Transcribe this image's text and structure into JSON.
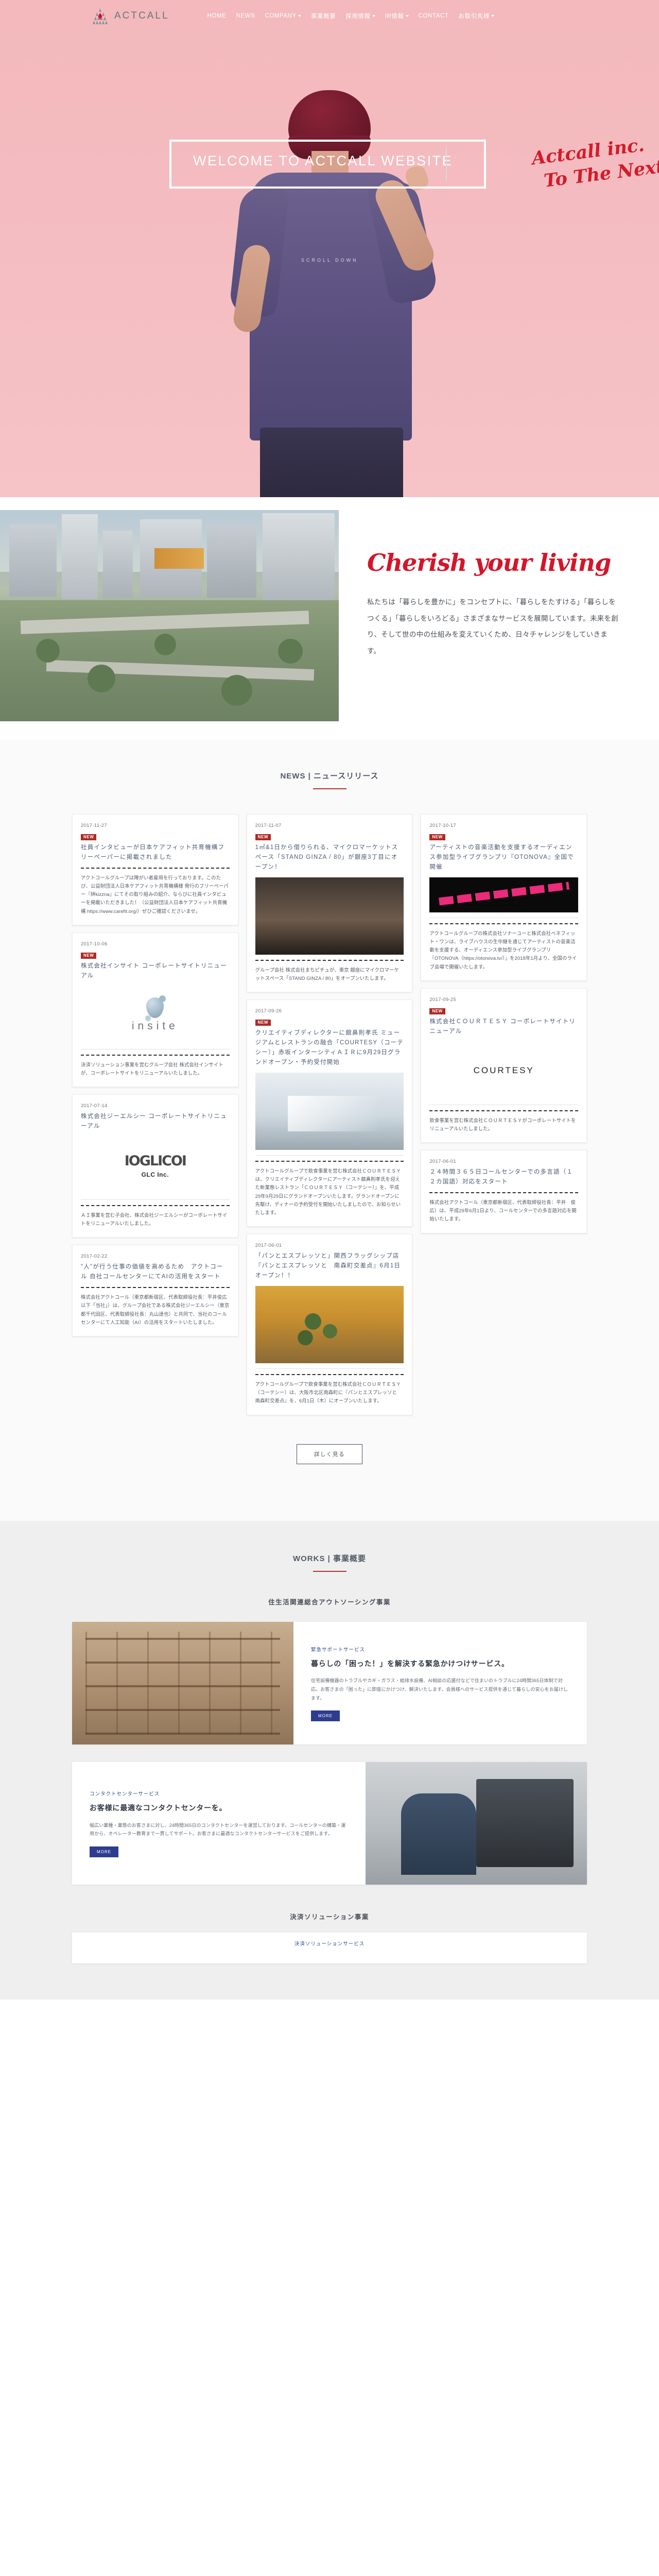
{
  "site": {
    "brand": "ACTCALL",
    "logo_icon": "actcall-triangle-logo"
  },
  "nav": {
    "items": [
      {
        "label": "HOME",
        "has_dropdown": false
      },
      {
        "label": "NEWS",
        "has_dropdown": false
      },
      {
        "label": "COMPANY",
        "has_dropdown": true
      },
      {
        "label": "事業概要",
        "has_dropdown": false
      },
      {
        "label": "採用情報",
        "has_dropdown": true
      },
      {
        "label": "IR情報",
        "has_dropdown": true
      },
      {
        "label": "CONTACT",
        "has_dropdown": false
      },
      {
        "label": "お取引先様",
        "has_dropdown": true
      }
    ]
  },
  "hero": {
    "frame_text": "WELCOME TO ACTCALL WEBSITE",
    "script_line1": "Actcall inc.",
    "script_line2": "To The Next",
    "scroll_hint": "SCROLL DOWN"
  },
  "cherish": {
    "heading": "Cherish your living",
    "body": "私たちは「暮らしを豊かに」をコンセプトに、「暮らしをたすける」「暮らしをつくる」「暮らしをいろどる」さまざまなサービスを展開しています。未来を創り、そして世の中の仕組みを変えていくため、日々チャレンジをしていきます。"
  },
  "news": {
    "title": "NEWS | ニュースリリース",
    "more_button": "詳しく見る",
    "columns": [
      {
        "cards": [
          {
            "date": "2017-11-27",
            "badge": "NEW",
            "title": "社員インタビューが日本ケアフィット共育機構フリーペーパーに掲載されました",
            "image": null,
            "logo": null,
            "body": "アクトコールグループは障がい者雇用を行っております。このたび、公益財団法人日本ケアフィット共育機構様 発行のフリーペーパー『絆kizzna』にてその取り組みの紹介、ならびに社員インタビューを掲載いただきました！（公益財団法人日本ケアフィット共育機構 https://www.carefit.org/）ぜひご確認くださいませ。"
          },
          {
            "date": "2017-10-06",
            "badge": "NEW",
            "title": "株式会社インサイト コーポレートサイトリニューアル",
            "image": null,
            "logo": "insite",
            "body": "決済ソリューション事業を営むグループ会社 株式会社インサイトが、コーポレートサイトをリニューアルいたしました。"
          },
          {
            "date": "2017-07-14",
            "badge": null,
            "title": "株式会社ジーエルシー コーポレートサイトリニューアル",
            "image": null,
            "logo": "glc",
            "body": "ＡＩ事業を営む子会社、株式会社ジーエルシーがコーポレートサイトをリニューアルいたしました。"
          },
          {
            "date": "2017-02-22",
            "badge": null,
            "title": "\"人\"が行う仕事の価値を高めるため　アクトコール 自社コールセンターにてAIの活用をスタート",
            "image": null,
            "logo": null,
            "body": "株式会社アクトコール（東京都新宿区、代表取締役社長：平井俊広 以下「当社」）は、グループ会社である株式会社ジーエルシー（東京都千代田区、代表取締役社長：丸山達也）と共同で、当社のコールセンターにて人工知能（AI）の活用をスタートいたしました。"
          }
        ]
      },
      {
        "cards": [
          {
            "date": "2017-11-07",
            "badge": "NEW",
            "title": "1㎡&1日から借りられる、マイクロマーケットスペース「STAND GINZA / 80」が銀座3丁目にオープン！",
            "image": "stand-ginza-photo",
            "logo": null,
            "body": "グループ会社 株式会社まちピチュが、東京 銀座にマイクロマーケットスペース「STAND GINZA / 80」をオープンいたします。"
          },
          {
            "date": "2017-09-26",
            "badge": "NEW",
            "title": "クリエイティブディレクターに舘鼻則孝氏 ミュージアムとレストランの融合「COURTESY（コーテシー）」赤坂インターシティＡＩＲに9月29日グランドオープン・予約受付開始",
            "image": "courtesy-interior-photo",
            "logo": null,
            "body": "アクトコールグループで飲食事業を営む株式会社ＣＯＵＲＴＥＳＹは、クリエイティブディレクターにアーティスト舘鼻則孝氏を迎えた新業態レストラン「ＣＯＵＲＴＥＳＹ（コーテシー）」を、平成29年9月29日にグランドオープンいたします。グランドオープンに先駆け、ディナーの予約受付を開始いたしましたので、お知らせいたします。"
          },
          {
            "date": "2017-06-01",
            "badge": null,
            "title": "「パンとエスプレッソと」関西フラッグシップ店　『パンとエスプレッソと　南森町交差点』6月1日オープン！！",
            "image": "pan-espresso-photo",
            "logo": null,
            "body": "アクトコールグループで飲食事業を営む株式会社ＣＯＵＲＴＥＳＹ（コーテシー）は、大阪市北区南森町に『パンとエスプレッソと　南森町交差点』を、6月1日（木）にオープンいたします。"
          }
        ]
      },
      {
        "cards": [
          {
            "date": "2017-10-17",
            "badge": "NEW",
            "title": "アーティストの音楽活動を支援するオーディエンス参加型ライブグランプリ『OTONOVA』全国で開催",
            "image": "otonova-photo",
            "logo": null,
            "body": "アクトコールグループの株式会社ソナーユーと株式会社ベネフィット・ワンは、ライブハウスの生中継を通じてアーティストの音楽活動を支援する、オーディエンス参加型ライブグランプリ『OTONOVA（https://otonova.tv/）』を2018年1月より、全国のライブ会場で開催いたします。"
          },
          {
            "date": "2017-09-25",
            "badge": "NEW",
            "title": "株式会社ＣＯＵＲＴＥＳＹ コーポレートサイトリニューアル",
            "image": null,
            "logo": "courtesy",
            "body": "飲食事業を営む株式会社ＣＯＵＲＴＥＳＹがコーポレートサイトをリニューアルいたしました。"
          },
          {
            "date": "2017-06-01",
            "badge": null,
            "title": "２４時間３６５日コールセンターでの多言語（１２カ国語）対応をスタート",
            "image": null,
            "logo": null,
            "body": "株式会社アクトコール（東京都新宿区、代表取締役社長：平井　俊広）は、平成29年6月1日より、コールセンターでの多言語対応を開始いたします。"
          }
        ]
      }
    ]
  },
  "works": {
    "title": "WORKS | 事業概要",
    "subtitle_1": "住生活関連総合アウトソーシング事業",
    "subtitle_2": "決済ソリューション事業",
    "rows": [
      {
        "kicker": "緊急サポートサービス",
        "title": "暮らしの「困った！」を解決する緊急かけつけサービス。",
        "desc": "住宅設備機器のトラブルやカギ・ガラス・給排水設備、AI相談の応援付などで住まいのトラブルに24時間365日体制で対応。お客さまの「困った」に即座にかけつけ、解決いたします。会員様へのサービス提供を通じて暮らしの安心をお届けします。",
        "more": "MORE",
        "photo": "shelf",
        "reverse": false
      },
      {
        "kicker": "コンタクトセンターサービス",
        "title": "お客様に最適なコンタクトセンターを。",
        "desc": "幅広い業種・業態のお客さまに対し、24時間365日のコンタクトセンターを運営しております。コールセンターの構築・運用から、オペレーター教育まで一貫してサポート。お客さまに最適なコンタクトセンターサービスをご提供します。",
        "more": "MORE",
        "photo": "cc",
        "reverse": true
      }
    ],
    "bottom_label": "決済ソリューションサービス"
  }
}
